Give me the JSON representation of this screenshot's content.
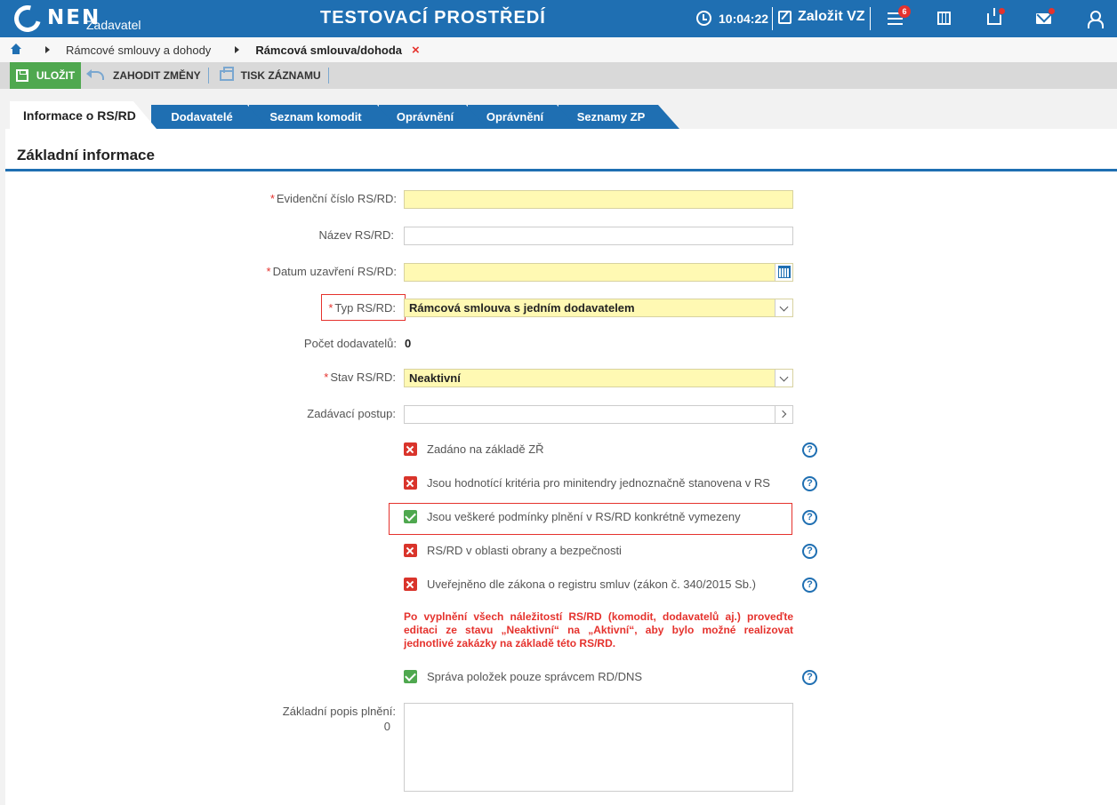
{
  "header": {
    "logo_text": "NEN",
    "logo_sub": "Zadavatel",
    "env_title": "TESTOVACÍ PROSTŘEDÍ",
    "time": "10:04:22",
    "new_vz_label": "Založit VZ",
    "menu_badge": "6"
  },
  "breadcrumb": {
    "items": [
      "Rámcové smlouvy a dohody"
    ],
    "current": "Rámcová smlouva/dohoda",
    "close": "×"
  },
  "toolbar": {
    "save_label": "ULOŽIT",
    "discard_label": "ZAHODIT ZMĚNY",
    "print_label": "TISK ZÁZNAMU"
  },
  "tabs": [
    "Informace o RS/RD",
    "Dodavatelé",
    "Seznam komodit",
    "Oprávnění",
    "Seznamy ZP"
  ],
  "section": {
    "title": "Základní informace"
  },
  "form": {
    "evid_label": "Evidenční číslo RS/RD:",
    "name_label": "Název RS/RD:",
    "date_label": "Datum uzavření RS/RD:",
    "type_label": "Typ RS/RD:",
    "type_value": "Rámcová smlouva s jedním dodavatelem",
    "count_label": "Počet dodavatelů:",
    "count_value": "0",
    "state_label": "Stav RS/RD:",
    "state_value": "Neaktivní",
    "procedure_label": "Zadávací postup:",
    "description_label": "Základní popis plnění:",
    "description_count": "0"
  },
  "checks": [
    {
      "label": "Zadáno na základě ZŘ",
      "checked": false
    },
    {
      "label": "Jsou hodnotící kritéria pro minitendry jednoznačně stanovena v RS",
      "checked": false
    },
    {
      "label": "Jsou veškeré podmínky plnění v RS/RD konkrétně vymezeny",
      "checked": true
    },
    {
      "label": "RS/RD v oblasti obrany a bezpečnosti",
      "checked": false
    },
    {
      "label": "Uveřejněno dle zákona o registru smluv (zákon č. 340/2015 Sb.)",
      "checked": false
    }
  ],
  "warning": "Po vyplnění všech náležitostí RS/RD (komodit, dodavatelů aj.) proveďte editaci ze stavu „Neaktivní“ na „Aktivní“, aby bylo možné realizovat jednotlivé zakázky na základě této RS/RD.",
  "extra_check": {
    "label": "Správa položek pouze správcem RD/DNS",
    "checked": true
  },
  "help_symbol": "?",
  "required_mark": "*",
  "colors": {
    "brand": "#1f6fb2",
    "save": "#4fa84f",
    "error": "#e5322d",
    "required_bg": "#fff9b3"
  }
}
